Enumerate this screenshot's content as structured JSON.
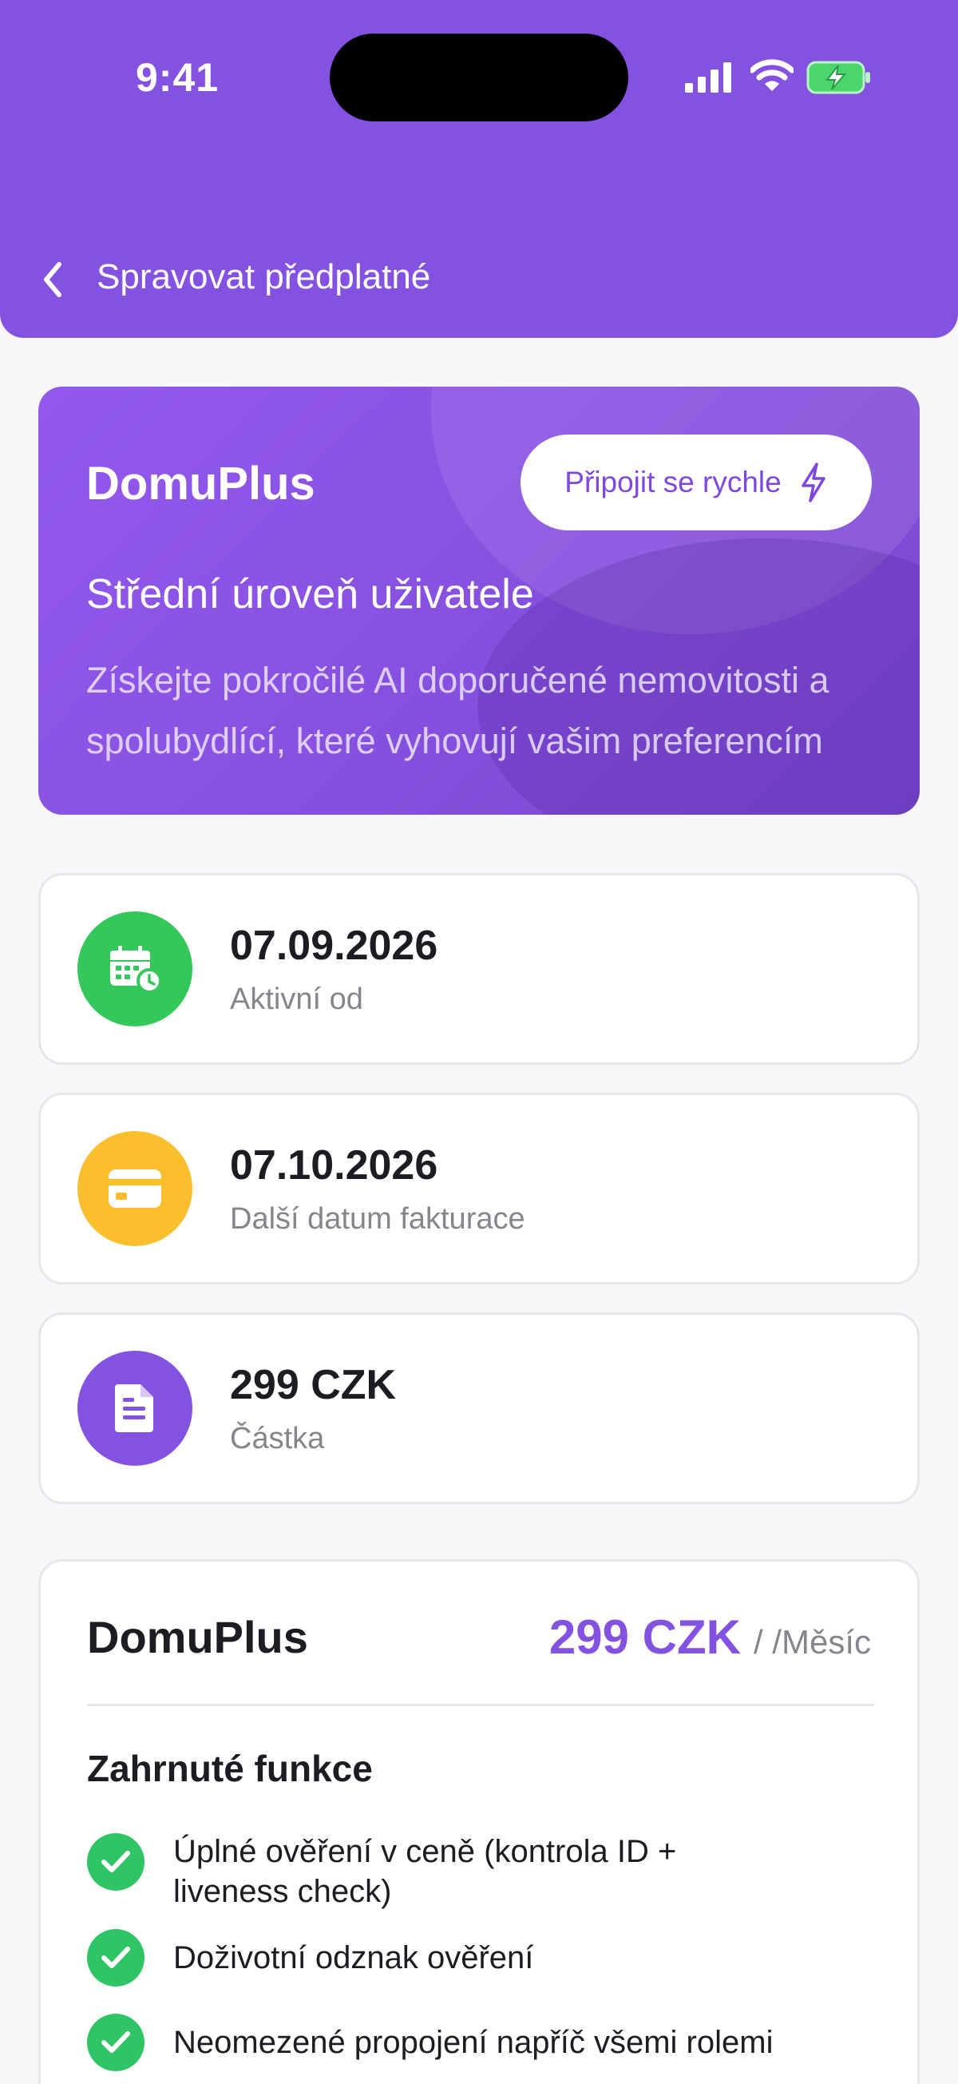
{
  "status_bar": {
    "time": "9:41"
  },
  "header": {
    "title": "Spravovat předplatné"
  },
  "hero": {
    "title": "DomuPlus",
    "join_label": "Připojit se rychle",
    "subtitle": "Střední úroveň uživatele",
    "description": "Získejte pokročilé AI doporučené nemovitosti a spolubydlící, které vyhovují vašim preferencím"
  },
  "info_cards": [
    {
      "value": "07.09.2026",
      "label": "Aktivní od",
      "icon": "calendar-clock-icon",
      "color": "#34c759"
    },
    {
      "value": "07.10.2026",
      "label": "Další datum fakturace",
      "icon": "credit-card-icon",
      "color": "#fbbf2d"
    },
    {
      "value": "299 CZK",
      "label": "Částka",
      "icon": "document-icon",
      "color": "#8452e0"
    }
  ],
  "plan": {
    "name": "DomuPlus",
    "price": "299 CZK",
    "period": "/ /Měsíc",
    "features_title": "Zahrnuté funkce",
    "features": [
      "Úplné ověření v ceně (kontrola ID + liveness check)",
      "Doživotní odznak ověření",
      "Neomezené propojení napříč všemi rolemi"
    ]
  },
  "colors": {
    "primary": "#8452e0",
    "success": "#2fc565",
    "warning": "#fbbf2d",
    "background": "#f7f7fa"
  }
}
